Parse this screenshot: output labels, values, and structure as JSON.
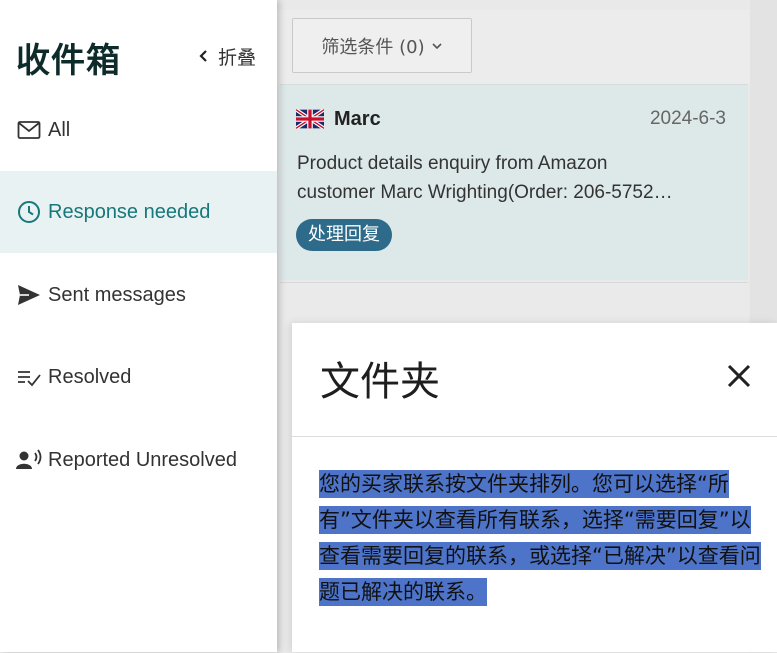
{
  "sidebar": {
    "title": "收件箱",
    "collapse_label": "折叠",
    "items": [
      {
        "label": "All",
        "icon": "mail-icon",
        "active": false
      },
      {
        "label": "Response needed",
        "icon": "clock-icon",
        "active": true
      },
      {
        "label": "Sent messages",
        "icon": "send-icon",
        "active": false
      },
      {
        "label": "Resolved",
        "icon": "check-list-icon",
        "active": false
      },
      {
        "label": "Reported Unresolved",
        "icon": "report-person-icon",
        "active": false
      }
    ]
  },
  "filter": {
    "label": "筛选条件 (0)"
  },
  "messages": [
    {
      "sender": "Marc",
      "flag": "uk-flag-icon",
      "date": "2024-6-3",
      "preview_line1": "Product details enquiry from Amazon",
      "preview_line2": "customer Marc Wrighting(Order: 206-5752…",
      "badge": "处理回复"
    }
  ],
  "modal": {
    "title": "文件夹",
    "body": "您的买家联系按文件夹排列。您可以选择“所有”文件夹以查看所有联系，选择“需要回复”以查看需要回复的联系，或选择“已解决”以查看问题已解决的联系。"
  },
  "colors": {
    "accent": "#17777a",
    "active_bg": "#e8f2f2",
    "badge_bg": "#2e6b8a",
    "highlight": "#4d74c9",
    "card_bg": "#dde8e8"
  }
}
